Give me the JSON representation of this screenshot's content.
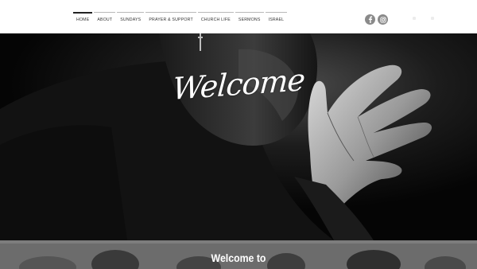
{
  "nav": {
    "items": [
      {
        "label": "HOME"
      },
      {
        "label": "ABOUT"
      },
      {
        "label": "SUNDAYS"
      },
      {
        "label": "PRAYER & SUPPORT"
      },
      {
        "label": "CHURCH LIFE"
      },
      {
        "label": "SERMONS"
      },
      {
        "label": "ISRAEL"
      }
    ],
    "active_index": 0
  },
  "social": {
    "icons": [
      "facebook-icon",
      "instagram-icon"
    ]
  },
  "hero": {
    "heading": "Welcome"
  },
  "intro": {
    "title": "Welcome to"
  },
  "colors": {
    "header_bg": "#ffffff",
    "nav_text": "#333333",
    "hero_bg": "#0b0b0b",
    "strip_bg": "#6f6f6f",
    "social_bg": "#8a8a8a"
  }
}
